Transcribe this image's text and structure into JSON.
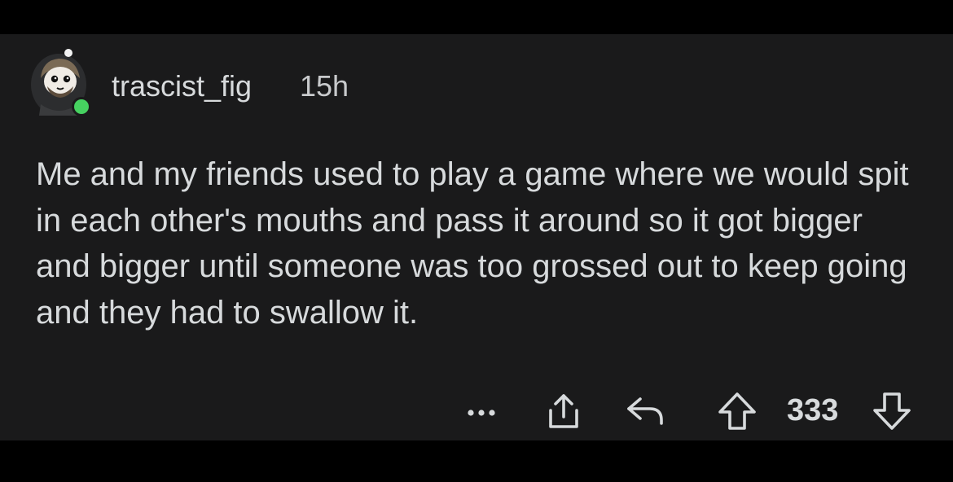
{
  "comment": {
    "author": "trascist_fig",
    "age": "15h",
    "body": "Me and my friends used to play a game where we would spit in each other's mouths and pass it around so it got bigger and bigger until someone was too grossed out to keep going and they had to swallow it.",
    "score": "333"
  },
  "avatar": {
    "online": true,
    "status_color": "#46d160"
  },
  "actions": {
    "icons": [
      "more-options-icon",
      "share-icon",
      "reply-icon",
      "upvote-icon",
      "downvote-icon"
    ]
  },
  "colors": {
    "background": "#1a1a1b",
    "text": "#d7dadc",
    "icon": "#d7dadc"
  }
}
